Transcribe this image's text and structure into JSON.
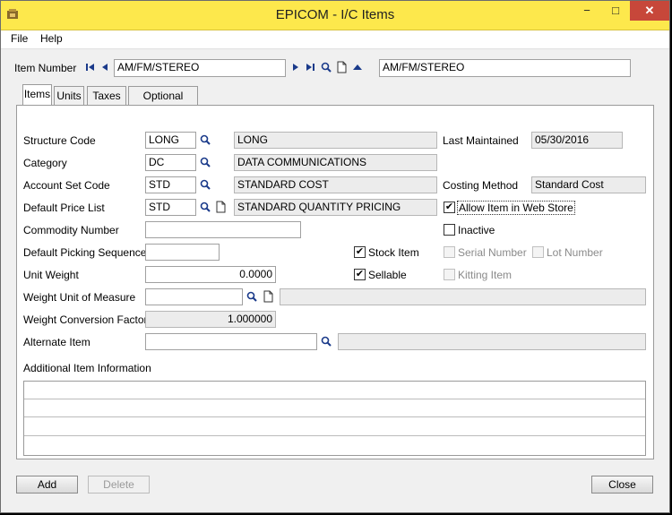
{
  "window": {
    "title": "EPICOM - I/C Items",
    "minimize_label": "−",
    "maximize_label": "□",
    "close_label": "✕"
  },
  "menu": [
    {
      "label": "File"
    },
    {
      "label": "Help"
    }
  ],
  "item_number": {
    "label": "Item Number",
    "value": "AM/FM/STEREO",
    "description": "AM/FM/STEREO"
  },
  "tabs": [
    {
      "label": "Items"
    },
    {
      "label": "Units"
    },
    {
      "label": "Taxes"
    },
    {
      "label": "Optional Fields"
    }
  ],
  "form": {
    "structure_code": {
      "label": "Structure Code",
      "value": "LONG",
      "description": "LONG"
    },
    "category": {
      "label": "Category",
      "value": "DC",
      "description": "DATA COMMUNICATIONS"
    },
    "account_set_code": {
      "label": "Account Set Code",
      "value": "STD",
      "description": "STANDARD COST"
    },
    "default_price_list": {
      "label": "Default Price List",
      "value": "STD",
      "description": "STANDARD QUANTITY PRICING"
    },
    "commodity_number": {
      "label": "Commodity Number",
      "value": ""
    },
    "default_picking_sequence": {
      "label": "Default Picking Sequence",
      "value": ""
    },
    "unit_weight": {
      "label": "Unit Weight",
      "value": "0.0000"
    },
    "weight_unit_of_measure": {
      "label": "Weight Unit of Measure",
      "value": "",
      "description": ""
    },
    "weight_conversion_factor": {
      "label": "Weight Conversion Factor",
      "value": "1.000000"
    },
    "alternate_item": {
      "label": "Alternate Item",
      "value": "",
      "description": ""
    },
    "last_maintained": {
      "label": "Last Maintained",
      "value": "05/30/2016"
    },
    "costing_method": {
      "label": "Costing Method",
      "value": "Standard Cost"
    },
    "additional_info_label": "Additional Item Information"
  },
  "checkboxes": {
    "allow_web_store": {
      "label": "Allow Item in Web Store",
      "checked": true
    },
    "inactive": {
      "label": "Inactive",
      "checked": false
    },
    "stock_item": {
      "label": "Stock Item",
      "checked": true
    },
    "serial_number": {
      "label": "Serial Number",
      "checked": false,
      "enabled": false
    },
    "lot_number": {
      "label": "Lot Number",
      "checked": false,
      "enabled": false
    },
    "sellable": {
      "label": "Sellable",
      "checked": true
    },
    "kitting_item": {
      "label": "Kitting Item",
      "checked": false,
      "enabled": false
    }
  },
  "buttons": {
    "add": "Add",
    "delete": "Delete",
    "close": "Close"
  },
  "icons": [
    "first-record-icon",
    "previous-record-icon",
    "next-record-icon",
    "last-record-icon",
    "finder-icon",
    "new-document-icon",
    "zoom-up-icon"
  ],
  "colors": {
    "titlebar": "#fde84c",
    "close_button": "#c7473a"
  }
}
